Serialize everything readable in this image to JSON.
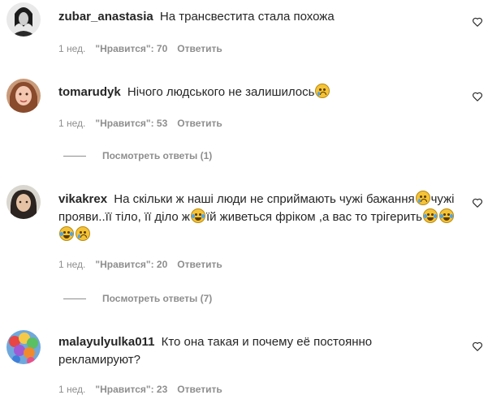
{
  "comments": [
    {
      "username": "zubar_anastasia",
      "text": "На трансвестита стала похожа",
      "time": "1 нед.",
      "likes": "\"Нравится\": 70",
      "reply": "Ответить"
    },
    {
      "username": "tomarudyk",
      "text": "Нічого людського не залишилось",
      "time": "1 нед.",
      "likes": "\"Нравится\": 53",
      "reply": "Ответить",
      "view_replies": "Посмотреть ответы (1)"
    },
    {
      "username": "vikakrex",
      "text_part1": "На скільки ж наші люди не сприймають чужі бажання",
      "text_part2": "чужі прояви..її тіло, її діло ж",
      "text_part3": "їй живеться фріком ,а вас то трігерить",
      "time": "1 нед.",
      "likes": "\"Нравится\": 20",
      "reply": "Ответить",
      "view_replies": "Посмотреть ответы (7)"
    },
    {
      "username": "malayulyulka011",
      "text": "Кто она такая и почему её постоянно рекламируют?",
      "time": "1 нед.",
      "likes": "\"Нравится\": 23",
      "reply": "Ответить"
    }
  ],
  "icons": {
    "like": "heart-outline-icon",
    "sad": "sad-face-emoji",
    "laugh": "laughing-tears-emoji"
  }
}
